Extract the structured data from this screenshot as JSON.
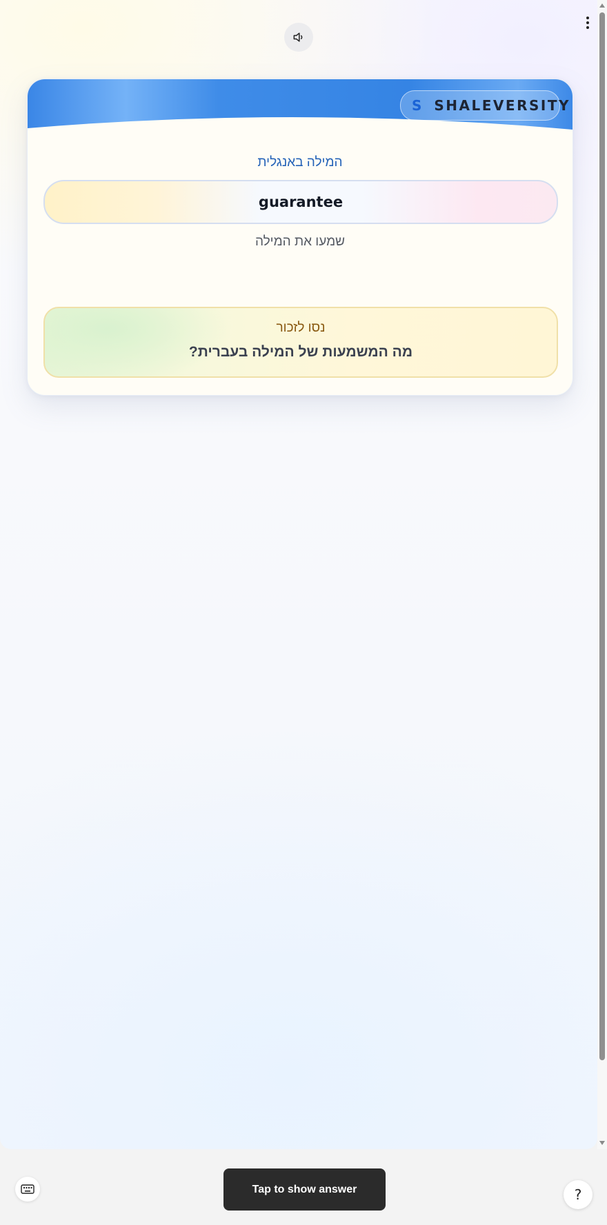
{
  "top_controls": {
    "sound_icon": "speaker-icon",
    "menu_icon": "vertical-dots-icon"
  },
  "card": {
    "brand": {
      "logo_letter": "S",
      "name": "SHALEVERSITY"
    },
    "language_label": "המילה באנגלית",
    "word": "guarantee",
    "listen_label": "שמעו את המילה",
    "remember": {
      "title": "נסו לזכור",
      "question": "מה המשמעות של המילה בעברית?"
    }
  },
  "bottom_bar": {
    "keyboard_icon": "keyboard-icon",
    "show_answer_label": "Tap to show answer",
    "help_label": "?"
  },
  "colors": {
    "header_blue": "#3b8ae8",
    "button_dark": "#2b2b2b",
    "label_blue": "#2563b8",
    "remember_title": "#8a5a12"
  }
}
